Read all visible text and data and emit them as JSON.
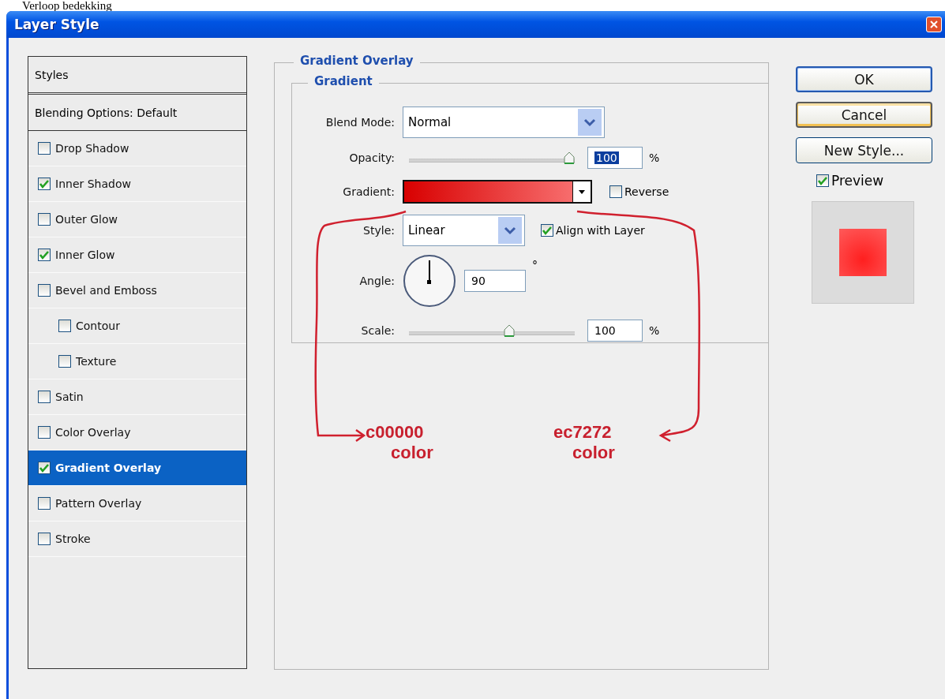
{
  "caption": "Verloop bedekking",
  "window": {
    "title": "Layer Style"
  },
  "styles_list": {
    "header": "Styles",
    "blending": "Blending Options: Default",
    "items": [
      {
        "label": "Drop Shadow",
        "checked": false,
        "selected": false
      },
      {
        "label": "Inner Shadow",
        "checked": true,
        "selected": false
      },
      {
        "label": "Outer Glow",
        "checked": false,
        "selected": false
      },
      {
        "label": "Inner Glow",
        "checked": true,
        "selected": false
      },
      {
        "label": "Bevel and Emboss",
        "checked": false,
        "selected": false,
        "children": [
          {
            "label": "Contour",
            "checked": false,
            "selected": false
          },
          {
            "label": "Texture",
            "checked": false,
            "selected": false
          }
        ]
      },
      {
        "label": "Satin",
        "checked": false,
        "selected": false
      },
      {
        "label": "Color Overlay",
        "checked": false,
        "selected": false
      },
      {
        "label": "Gradient Overlay",
        "checked": true,
        "selected": true
      },
      {
        "label": "Pattern Overlay",
        "checked": false,
        "selected": false
      },
      {
        "label": "Stroke",
        "checked": false,
        "selected": false
      }
    ]
  },
  "panel": {
    "title": "Gradient Overlay",
    "group": "Gradient",
    "blend_mode": {
      "label": "Blend Mode:",
      "value": "Normal"
    },
    "opacity": {
      "label": "Opacity:",
      "level": 1,
      "value": "100",
      "unit": "%"
    },
    "gradient": {
      "label": "Gradient:",
      "reverse": {
        "label": "Reverse",
        "checked": false
      }
    },
    "style": {
      "label": "Style:",
      "value": "Linear",
      "align": {
        "label": "Align with Layer",
        "checked": true
      }
    },
    "angle": {
      "label": "Angle:",
      "value": "90",
      "unit": "°"
    },
    "scale": {
      "label": "Scale:",
      "level": 0.61,
      "value": "100",
      "unit": "%"
    }
  },
  "annotations": [
    {
      "lines": [
        "c00000",
        "color"
      ]
    },
    {
      "lines": [
        "ec7272",
        "color"
      ]
    }
  ],
  "side": {
    "buttons": [
      {
        "label": "OK",
        "kind": "default"
      },
      {
        "label": "Cancel",
        "kind": "hot"
      },
      {
        "label": "New Style...",
        "kind": "normal"
      }
    ],
    "preview": {
      "label": "Preview",
      "checked": true
    }
  }
}
